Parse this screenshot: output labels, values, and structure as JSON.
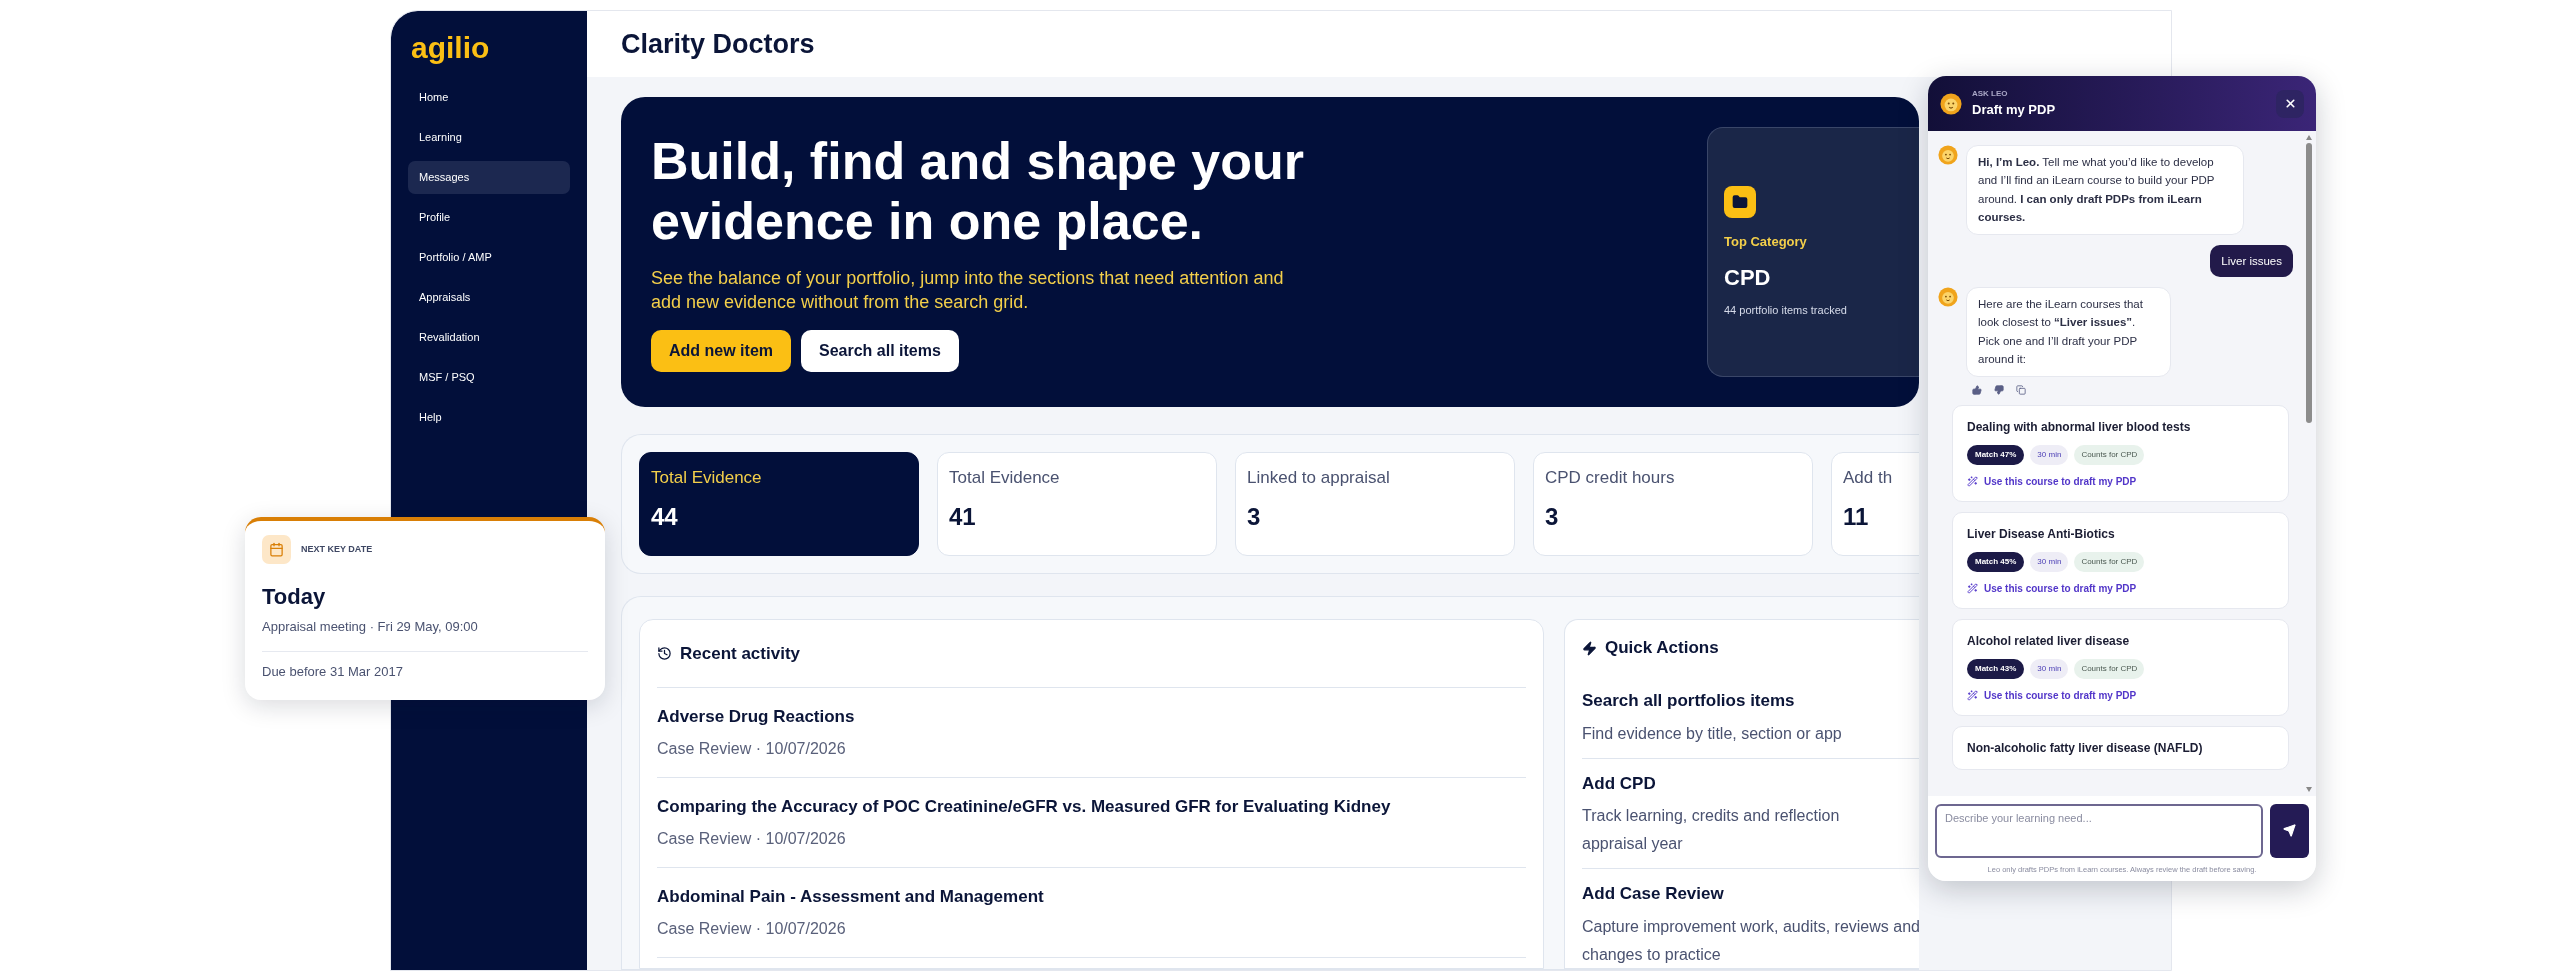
{
  "sidebar": {
    "logo": "agilio",
    "items": [
      {
        "label": "Home",
        "selected": false
      },
      {
        "label": "Learning",
        "selected": false
      },
      {
        "label": "Messages",
        "selected": true
      },
      {
        "label": "Profile",
        "selected": false
      },
      {
        "label": "Portfolio / AMP",
        "selected": false
      },
      {
        "label": "Appraisals",
        "selected": false
      },
      {
        "label": "Revalidation",
        "selected": false
      },
      {
        "label": "MSF / PSQ",
        "selected": false
      },
      {
        "label": "Help",
        "selected": false
      }
    ]
  },
  "header": {
    "title": "Clarity Doctors"
  },
  "hero": {
    "heading": "Build, find and shape your evidence in one place.",
    "description": "See the balance of your portfolio, jump into the sections that need attention and add new evidence without from the search grid.",
    "buttons": [
      {
        "label": "Add new item",
        "kind": "primary"
      },
      {
        "label": "Search all items",
        "kind": "secondary"
      }
    ],
    "top_category": {
      "label": "Top Category",
      "value": "CPD",
      "caption": "44 portfolio items tracked"
    }
  },
  "stats": [
    {
      "label": "Total Evidence",
      "value": "44",
      "selected": true
    },
    {
      "label": "Total Evidence",
      "value": "41",
      "selected": false
    },
    {
      "label": "Linked to appraisal",
      "value": "3",
      "selected": false
    },
    {
      "label": "CPD credit hours",
      "value": "3",
      "selected": false
    },
    {
      "label": "Add th",
      "value": "11",
      "selected": false
    }
  ],
  "recent_activity": {
    "title": "Recent activity",
    "items": [
      {
        "title": "Adverse Drug Reactions",
        "meta": "Case Review · 10/07/2026"
      },
      {
        "title": "Comparing the Accuracy of POC Creatinine/eGFR vs. Measured GFR for Evaluating Kidney",
        "meta": "Case Review · 10/07/2026"
      },
      {
        "title": "Abdominal Pain - Assessment and Management",
        "meta": "Case Review · 10/07/2026"
      }
    ]
  },
  "quick_actions": {
    "title": "Quick Actions",
    "items": [
      {
        "title": "Search all portfolios items",
        "lines": [
          "Find evidence by title, section or app"
        ]
      },
      {
        "title": "Add CPD",
        "lines": [
          "Track learning, credits and reflection",
          "appraisal year"
        ]
      },
      {
        "title": "Add Case Review",
        "lines": [
          "Capture improvement work, audits, reviews and",
          "changes to practice"
        ]
      }
    ]
  },
  "key_date": {
    "label": "NEXT KEY DATE",
    "title": "Today",
    "detail": "Appraisal meeting · Fri 29 May, 09:00",
    "due": "Due before 31 Mar 2017"
  },
  "chat": {
    "eyebrow": "ASK LEO",
    "title": "Draft my PDP",
    "messages": [
      {
        "kind": "bot",
        "text": "**Hi, I’m Leo.** Tell me what you’d like to develop and I’ll find an iLearn course to build your PDP around. **I can only draft PDPs from iLearn courses.**"
      },
      {
        "kind": "user",
        "text": "Liver issues"
      },
      {
        "kind": "bot",
        "text": "Here are the iLearn courses that look closest to **“Liver issues”**. Pick one and I’ll draft your PDP around it:",
        "feedback": true
      }
    ],
    "courses": [
      {
        "title": "Dealing with abnormal liver blood tests",
        "match": "Match 47%",
        "duration": "30 min",
        "tag": "Counts for CPD",
        "action": "Use this course to draft my PDP"
      },
      {
        "title": "Liver Disease Anti-Biotics",
        "match": "Match 45%",
        "duration": "30 min",
        "tag": "Counts for CPD",
        "action": "Use this course to draft my PDP"
      },
      {
        "title": "Alcohol related liver disease",
        "match": "Match 43%",
        "duration": "30 min",
        "tag": "Counts for CPD",
        "action": "Use this course to draft my PDP"
      },
      {
        "title": "Non-alcoholic fatty liver disease (NAFLD)"
      }
    ],
    "input": {
      "placeholder": "Describe your learning need..."
    },
    "disclaimer": "Leo only drafts PDPs from iLearn courses. Always review the draft before saving."
  }
}
